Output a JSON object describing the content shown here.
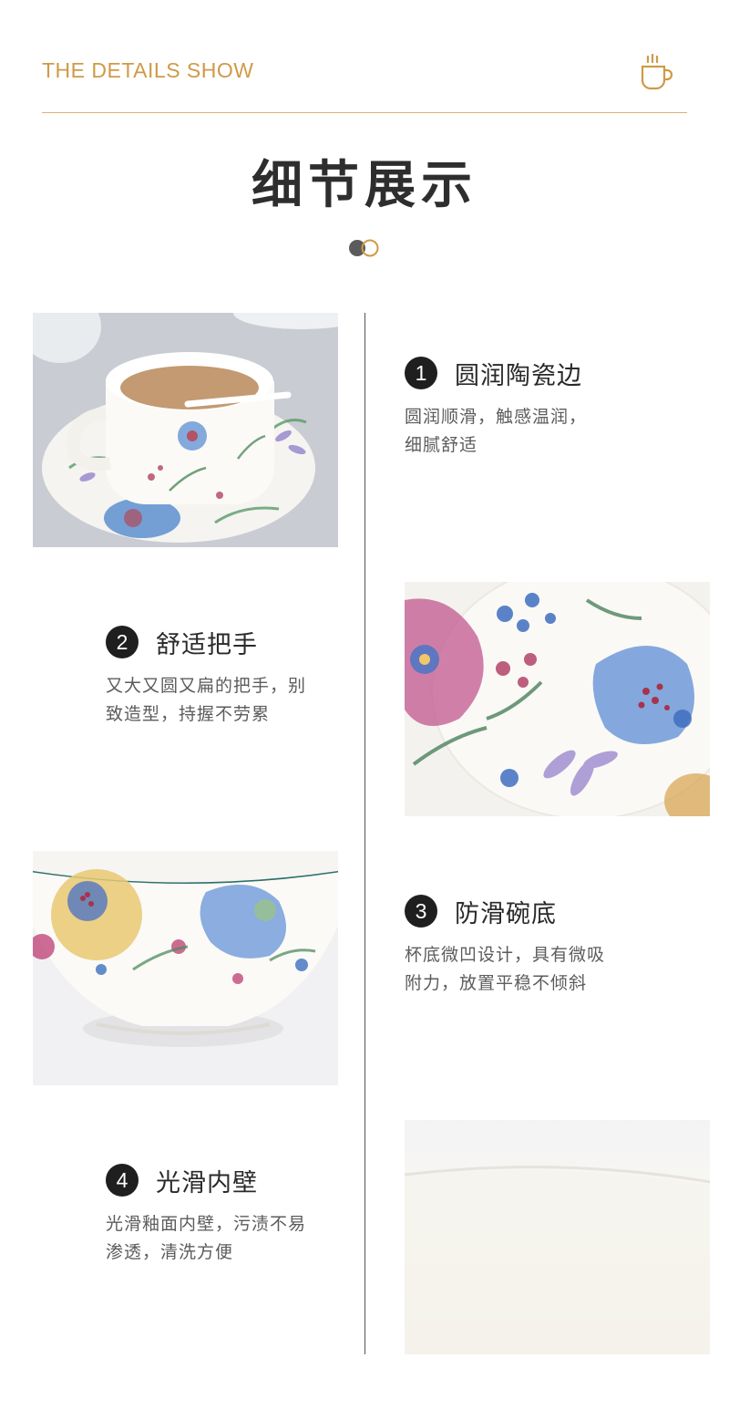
{
  "header": {
    "english_title": "THE DETAILS SHOW",
    "chinese_title": "细节展示",
    "icon": "coffee-cup-icon",
    "accent_color": "#cf9a47",
    "dot_colors": [
      "#5b5b5b",
      "#cf9a47"
    ]
  },
  "features": [
    {
      "number": "1",
      "title": "圆润陶瓷边",
      "desc_lines": [
        "圆润顺滑，触感温润，",
        "细腻舒适"
      ]
    },
    {
      "number": "2",
      "title": "舒适把手",
      "desc_lines": [
        "又大又圆又扁的把手，别",
        "致造型，持握不劳累"
      ]
    },
    {
      "number": "3",
      "title": "防滑碗底",
      "desc_lines": [
        "杯底微凹设计，具有微吸",
        "附力，放置平稳不倾斜"
      ]
    },
    {
      "number": "4",
      "title": "光滑内壁",
      "desc_lines": [
        "光滑釉面内壁，污渍不易",
        "渗透，清洗方便"
      ]
    }
  ]
}
